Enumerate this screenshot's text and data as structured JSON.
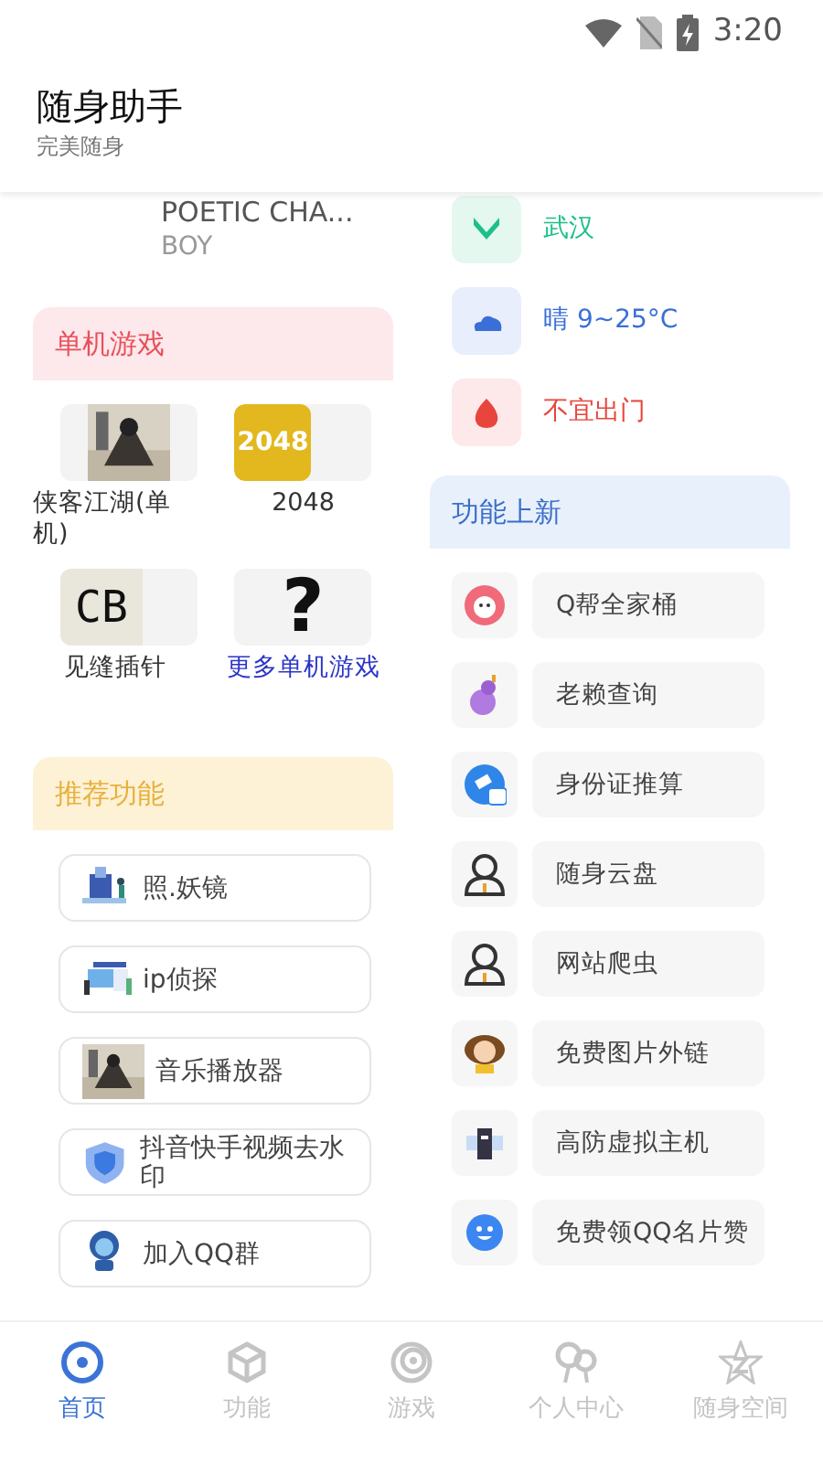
{
  "status_bar": {
    "time": "3:20"
  },
  "header": {
    "title": "随身助手",
    "subtitle": "完美随身"
  },
  "song": {
    "title": "POETIC CHA...",
    "artist": "BOY"
  },
  "weather": [
    {
      "kind": "location",
      "text": "武汉",
      "color": "#1dbf8a"
    },
    {
      "kind": "weather",
      "text": "晴 9~25°C",
      "color": "#3b6fd8"
    },
    {
      "kind": "advice",
      "text": "不宜出门",
      "color": "#e8453c"
    }
  ],
  "games": {
    "title": "单机游戏",
    "items": [
      {
        "kind": "picture",
        "label": "侠客江湖(单机)"
      },
      {
        "kind": "tile",
        "tile_text": "2048",
        "label": "2048"
      },
      {
        "kind": "letters",
        "tile_text": "CB",
        "label": "见缝插针"
      },
      {
        "kind": "more",
        "tile_text": "?",
        "label": "更多单机游戏"
      }
    ]
  },
  "recommended": {
    "title": "推荐功能",
    "items": [
      {
        "label": "照.妖镜"
      },
      {
        "label": "ip侦探"
      },
      {
        "label": "音乐播放器"
      },
      {
        "label": "抖音快手视频去水印"
      },
      {
        "label": "加入QQ群"
      }
    ]
  },
  "new_features": {
    "title": "功能上新",
    "items": [
      {
        "label": "Q帮全家桶"
      },
      {
        "label": "老赖查询"
      },
      {
        "label": "身份证推算"
      },
      {
        "label": "随身云盘"
      },
      {
        "label": "网站爬虫"
      },
      {
        "label": "免费图片外链"
      },
      {
        "label": "高防虚拟主机"
      },
      {
        "label": "免费领QQ名片赞"
      }
    ]
  },
  "bottom_nav": [
    {
      "label": "首页",
      "selected": true
    },
    {
      "label": "功能",
      "selected": false
    },
    {
      "label": "游戏",
      "selected": false
    },
    {
      "label": "个人中心",
      "selected": false
    },
    {
      "label": "随身空间",
      "selected": false
    }
  ]
}
